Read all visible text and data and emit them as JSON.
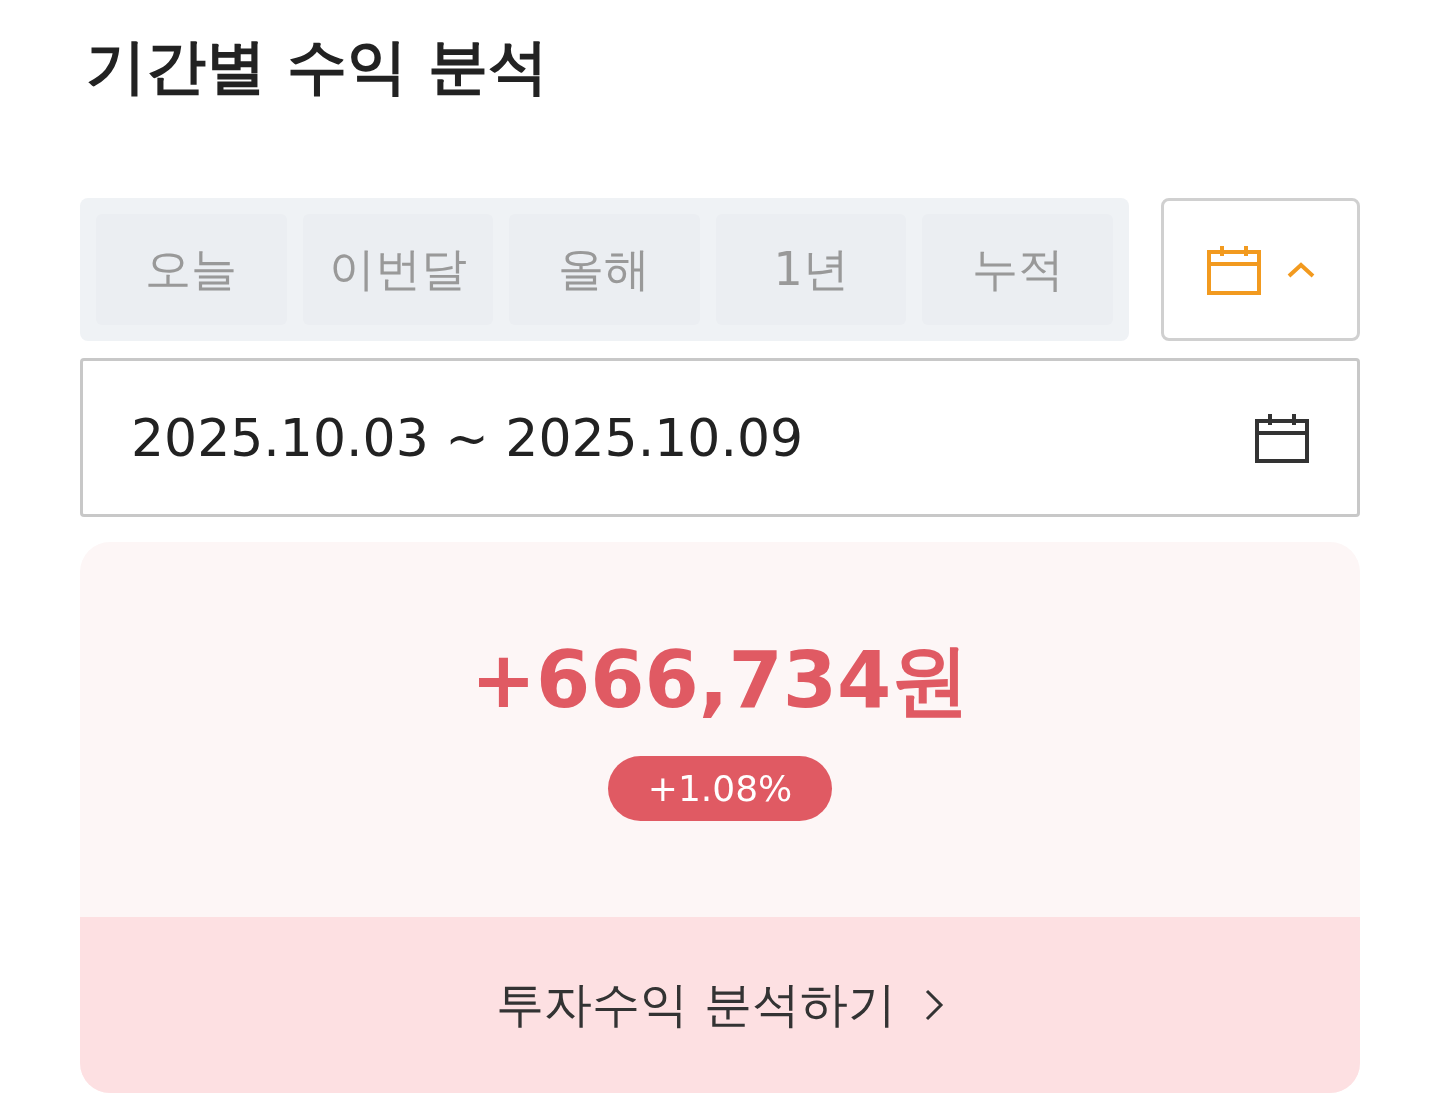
{
  "title": "기간별 수익 분석",
  "period_tabs": [
    {
      "label": "오늘",
      "selected": false
    },
    {
      "label": "이번달",
      "selected": false
    },
    {
      "label": "올해",
      "selected": false
    },
    {
      "label": "1년",
      "selected": false
    },
    {
      "label": "누적",
      "selected": false
    }
  ],
  "calendar_toggle": {
    "expanded": true
  },
  "date_range": {
    "value": "2025.10.03 ~ 2025.10.09"
  },
  "summary": {
    "amount": "+666,734원",
    "rate": "+1.08%",
    "action": "투자수익 분석하기"
  }
}
